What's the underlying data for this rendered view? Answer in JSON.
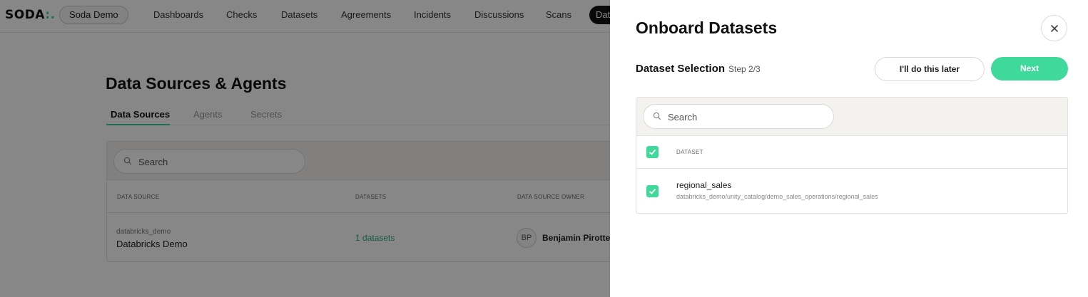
{
  "nav": {
    "logo": "SODA",
    "logo_accent": ":.",
    "org": "Soda Demo",
    "items": [
      "Dashboards",
      "Checks",
      "Datasets",
      "Agreements",
      "Incidents",
      "Discussions",
      "Scans"
    ],
    "active_item": "Dat"
  },
  "page": {
    "title": "Data Sources & Agents",
    "tabs": [
      "Data Sources",
      "Agents",
      "Secrets"
    ],
    "active_tab": "Data Sources"
  },
  "datasources": {
    "search_placeholder": "Search",
    "columns": [
      "DATA SOURCE",
      "DATASETS",
      "DATA SOURCE OWNER"
    ],
    "rows": [
      {
        "sub": "databricks_demo",
        "name": "Databricks Demo",
        "datasets": "1 datasets",
        "owner_initials": "BP",
        "owner_name": "Benjamin Pirotte"
      }
    ]
  },
  "drawer": {
    "title": "Onboard Datasets",
    "close_icon": "close-icon",
    "step_title": "Dataset Selection",
    "step_count": "Step 2/3",
    "later_label": "I'll do this later",
    "next_label": "Next",
    "search_placeholder": "Search",
    "column_header": "DATASET",
    "rows": [
      {
        "name": "regional_sales",
        "path": "databricks_demo/unity_catalog/demo_sales_operations/regional_sales",
        "checked": true
      }
    ]
  },
  "colors": {
    "accent": "#3fd99c",
    "link": "#2fae79",
    "overlay": "rgba(0,0,0,0.47)"
  }
}
